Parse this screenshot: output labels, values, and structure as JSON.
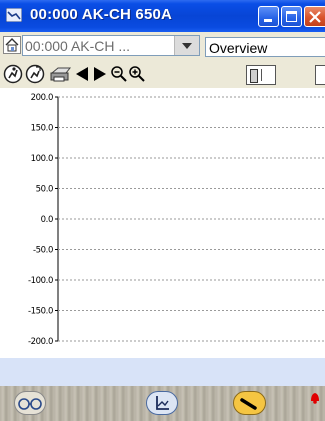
{
  "window": {
    "title": "00:000 AK-CH 650A"
  },
  "toolbar": {
    "device_combo_value": "00:000 AK-CH ...",
    "view_select_value": "Overview"
  },
  "icons": {
    "app": "chart-line-icon",
    "home": "home-icon",
    "tool1": "run-icon",
    "tool2": "run-alt-icon",
    "print": "printer-icon",
    "prev": "arrow-left-icon",
    "next": "arrow-right-icon",
    "zoom_out": "zoom-out-icon",
    "zoom_in": "zoom-in-icon",
    "footer_left": "glasses-icon",
    "footer_mid": "chart-axes-icon",
    "footer_right": "wrench-icon",
    "footer_alarm": "alarm-bell-icon"
  },
  "chart_data": {
    "type": "line",
    "title": "",
    "xlabel": "",
    "ylabel": "",
    "ylim": [
      -200.0,
      200.0
    ],
    "y_ticks": [
      "200.0",
      "150.0",
      "100.0",
      "50.0",
      "0.0",
      "-50.0",
      "-100.0",
      "-150.0",
      "-200.0"
    ],
    "series": [],
    "grid": true
  },
  "colors": {
    "titlebar": "#0745d6",
    "footer_active": "#f5c542",
    "alarm": "#e00000"
  }
}
